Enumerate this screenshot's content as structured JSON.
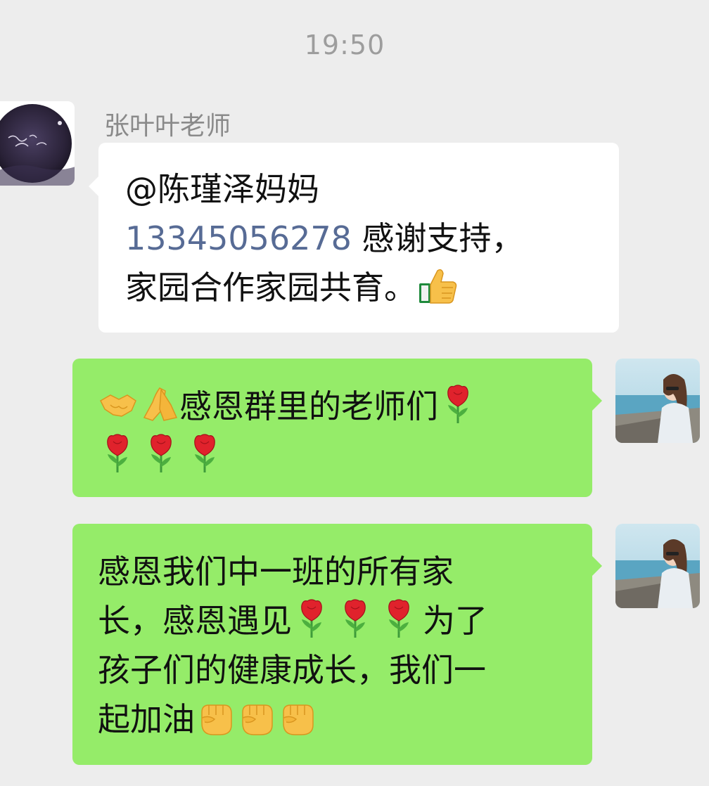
{
  "timestamp": "19:50",
  "messages": [
    {
      "sender": "张叶叶老师",
      "direction": "incoming",
      "mention": "@陈瑾泽妈妈",
      "phone": "13345056278",
      "text_after_phone": " 感谢支持，",
      "text_line3": "家园合作家园共育。",
      "emoji": [
        "thumbs-up-icon"
      ]
    },
    {
      "direction": "outgoing",
      "line1": "感恩群里的老师们",
      "line1_prefix_emoji": [
        "handshake-icon",
        "pray-icon"
      ],
      "emoji": [
        "rose-icon",
        "rose-icon",
        "rose-icon",
        "rose-icon"
      ]
    },
    {
      "direction": "outgoing",
      "line1": "感恩我们中一班的所有家",
      "line2_a": "长，感恩遇见",
      "line2_b": "为了",
      "line3": "孩子们的健康成长，我们一",
      "line4": "起加油",
      "emoji": [
        "rose-icon",
        "rose-icon",
        "rose-icon",
        "fist-icon",
        "fist-icon",
        "fist-icon"
      ]
    }
  ],
  "colors": {
    "background": "#ededed",
    "incoming_bubble": "#ffffff",
    "outgoing_bubble": "#95ec69",
    "link": "#576b95",
    "timestamp": "#9d9d9d"
  }
}
